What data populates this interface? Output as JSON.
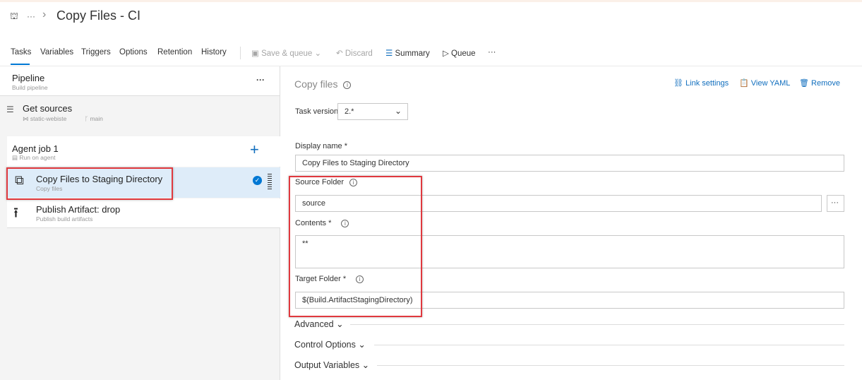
{
  "header": {
    "title": "Copy Files - CI",
    "ellipsis": "···",
    "chevron": "›"
  },
  "tabs": [
    "Tasks",
    "Variables",
    "Triggers",
    "Options",
    "Retention",
    "History"
  ],
  "toolbar": {
    "save_queue": "Save & queue",
    "discard": "Discard",
    "summary": "Summary",
    "queue": "Queue",
    "more": "···"
  },
  "pipeline": {
    "title": "Pipeline",
    "subtitle": "Build pipeline",
    "more": "···"
  },
  "get_sources": {
    "title": "Get sources",
    "repo": "static-webiste",
    "branch": "main"
  },
  "agent_job": {
    "title": "Agent job 1",
    "subtitle": "Run on agent",
    "add": "+"
  },
  "tasks": [
    {
      "title": "Copy Files to Staging Directory",
      "subtitle": "Copy files",
      "selected": true
    },
    {
      "title": "Publish Artifact: drop",
      "subtitle": "Publish build artifacts"
    }
  ],
  "detail": {
    "title": "Copy files",
    "link_settings": "Link settings",
    "view_yaml": "View YAML",
    "remove": "Remove",
    "task_version_label": "Task version",
    "task_version": "2.*",
    "display_name_label": "Display name *",
    "display_name": "Copy Files to Staging Directory",
    "source_folder_label": "Source Folder",
    "source_folder": "source",
    "browse": "···",
    "contents_label": "Contents *",
    "contents": "**",
    "target_folder_label": "Target Folder *",
    "target_folder": "$(Build.ArtifactStagingDirectory)",
    "sections": [
      "Advanced",
      "Control Options",
      "Output Variables"
    ]
  },
  "colors": {
    "accent": "#0078d4",
    "highlight": "#e0393e",
    "selected_row": "#deecf9"
  }
}
